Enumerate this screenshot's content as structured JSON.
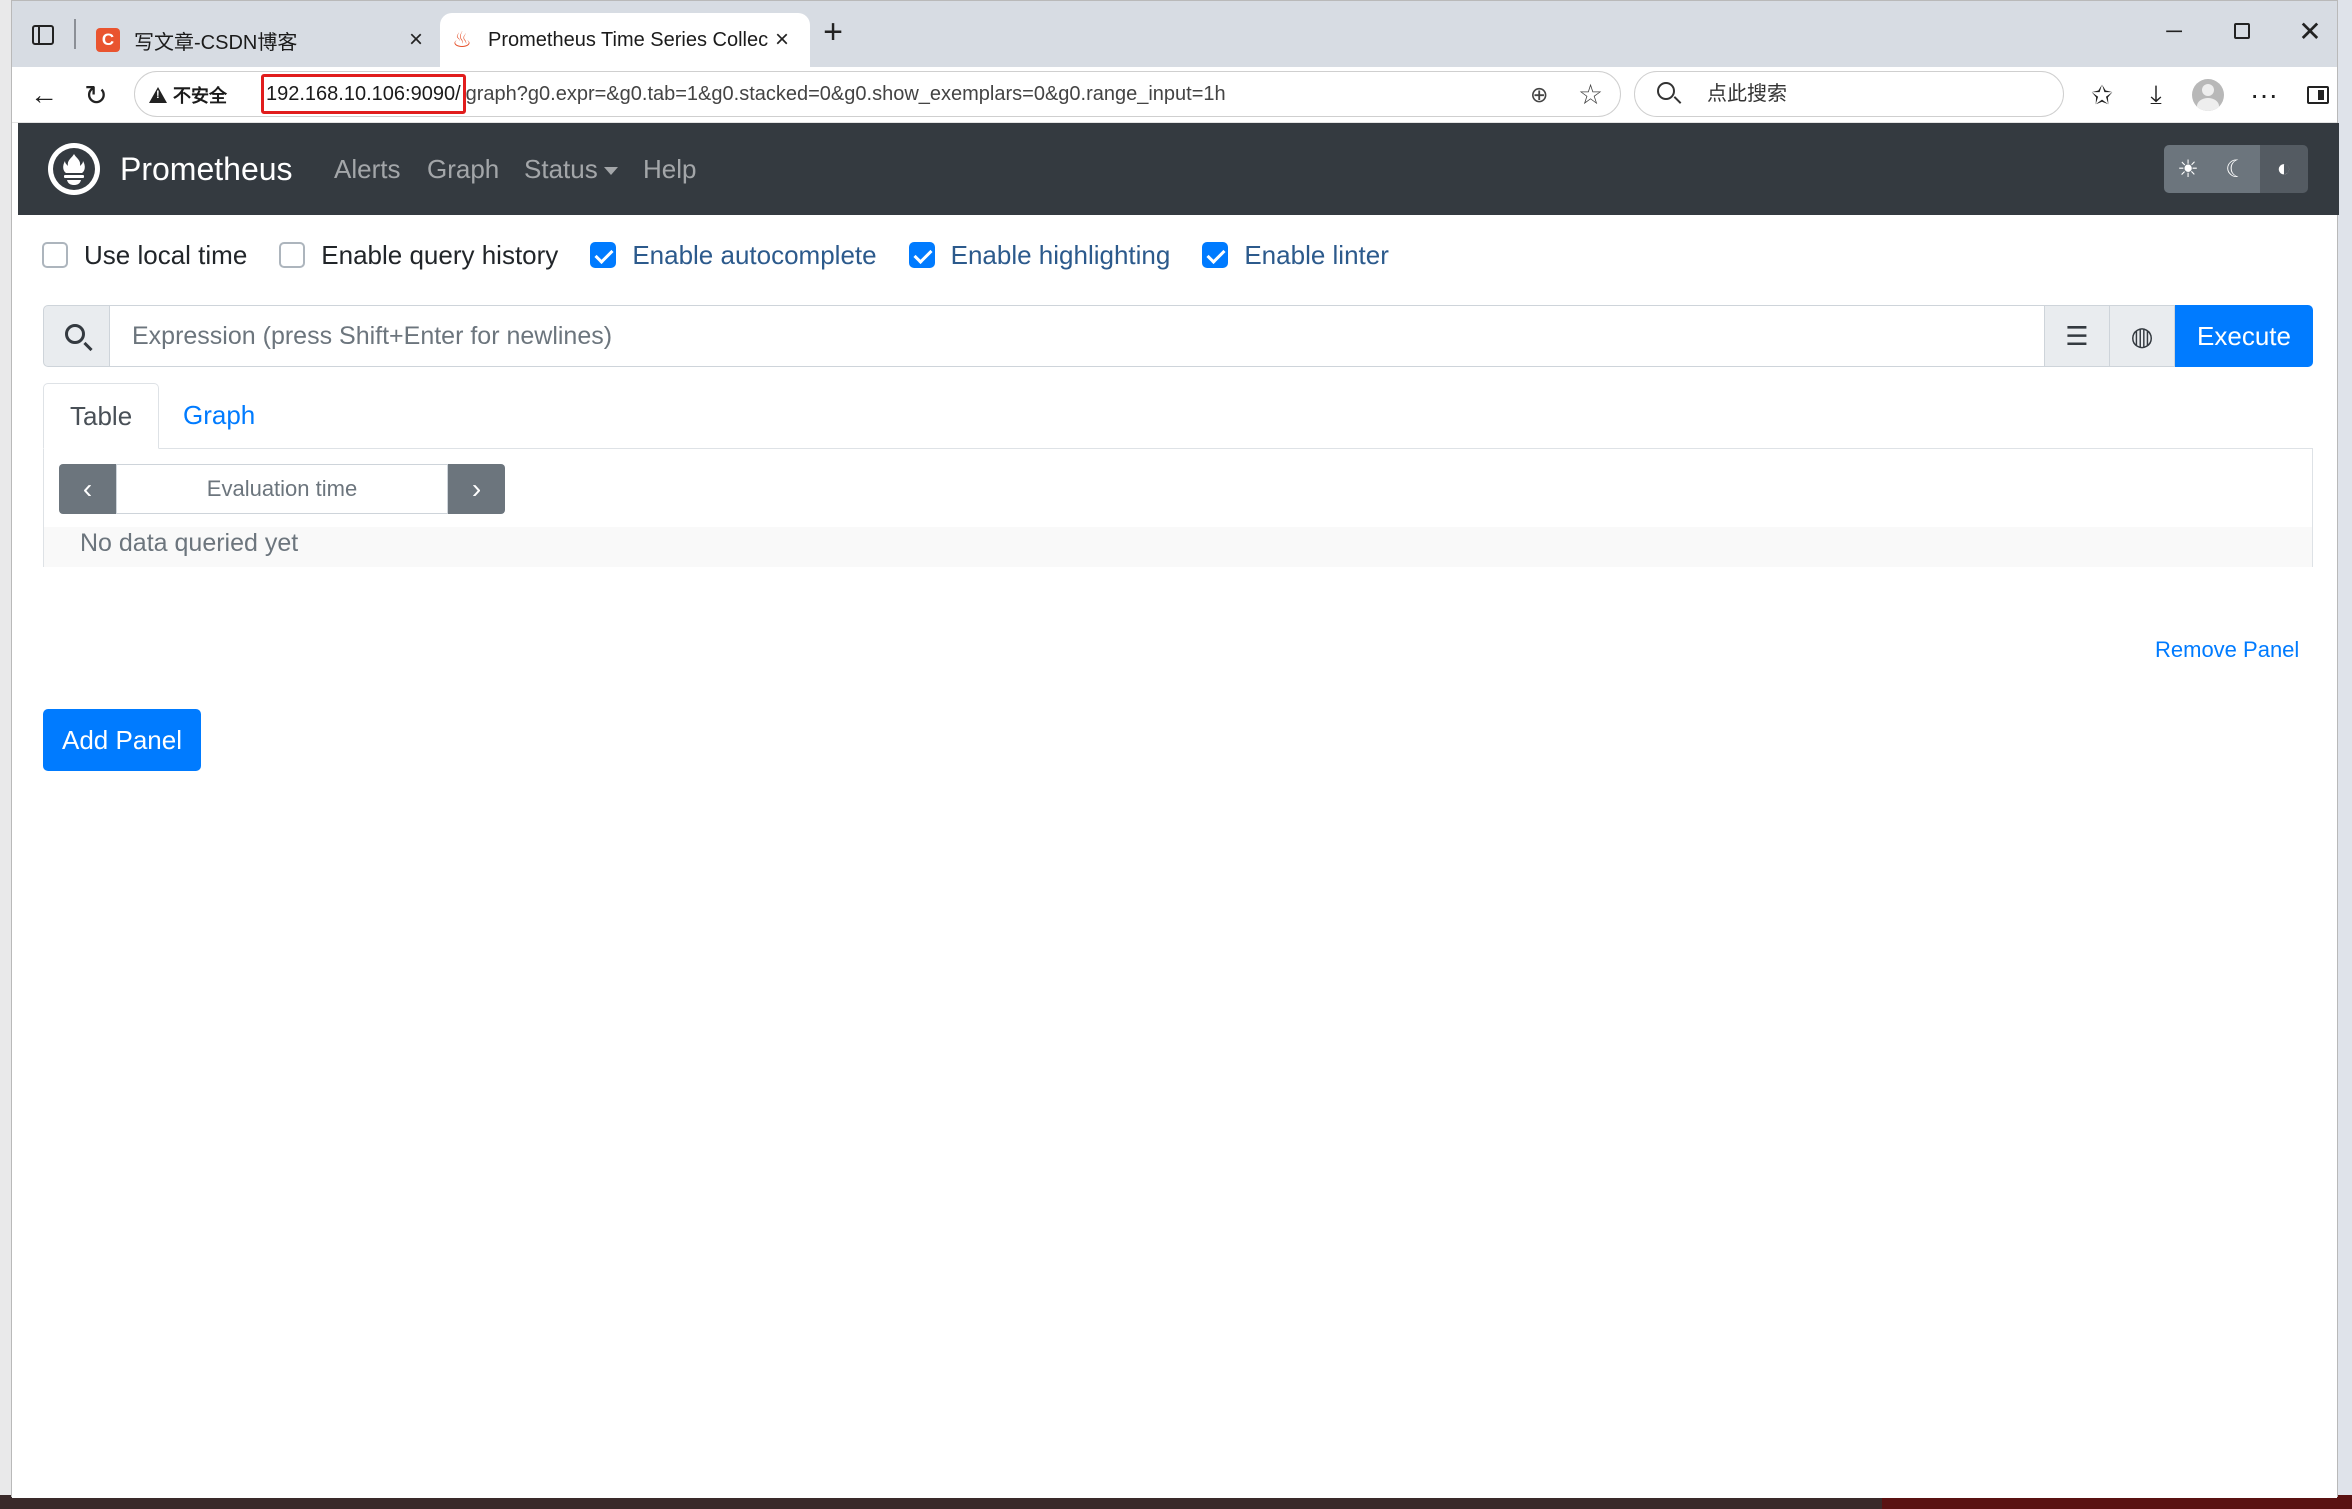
{
  "browser": {
    "tabs": [
      {
        "title": "写文章-CSDN博客",
        "favicon": "C",
        "active": false
      },
      {
        "title": "Prometheus Time Series Collection and Processing Server",
        "active": true
      }
    ],
    "new_tab": "+",
    "window_controls": {
      "minimize": "─",
      "close": "✕"
    },
    "nav": {
      "back": "←",
      "reload": "↻"
    },
    "address": {
      "security_label": "不安全",
      "host": "192.168.10.106:9090/",
      "path": "graph?g0.expr=&g0.tab=1&g0.stacked=0&g0.show_exemplars=0&g0.range_input=1h",
      "zoom_icon": "⊕",
      "star_icon": "☆"
    },
    "search": {
      "placeholder": "点此搜索"
    },
    "toolbar": {
      "favorites": "✩",
      "download": "⤓",
      "more": "···"
    }
  },
  "app": {
    "brand": "Prometheus",
    "nav": {
      "alerts": "Alerts",
      "graph": "Graph",
      "status": "Status",
      "help": "Help"
    },
    "theme_buttons": {
      "light": "☀",
      "dark": "☾",
      "auto": "◐"
    },
    "options": [
      {
        "label": "Use local time",
        "checked": false
      },
      {
        "label": "Enable query history",
        "checked": false
      },
      {
        "label": "Enable autocomplete",
        "checked": true
      },
      {
        "label": "Enable highlighting",
        "checked": true
      },
      {
        "label": "Enable linter",
        "checked": true
      }
    ],
    "query": {
      "placeholder": "Expression (press Shift+Enter for newlines)",
      "format_icon": "☰",
      "metrics_icon": "◍",
      "execute_label": "Execute"
    },
    "panel": {
      "tabs": {
        "table": "Table",
        "graph": "Graph"
      },
      "eval_prev": "‹",
      "eval_next": "›",
      "eval_placeholder": "Evaluation time",
      "empty_message": "No data queried yet",
      "remove_label": "Remove Panel"
    },
    "add_panel_label": "Add Panel",
    "colors": {
      "navbar": "#343a40",
      "primary": "#007bff",
      "secondary": "#6c757d"
    }
  }
}
